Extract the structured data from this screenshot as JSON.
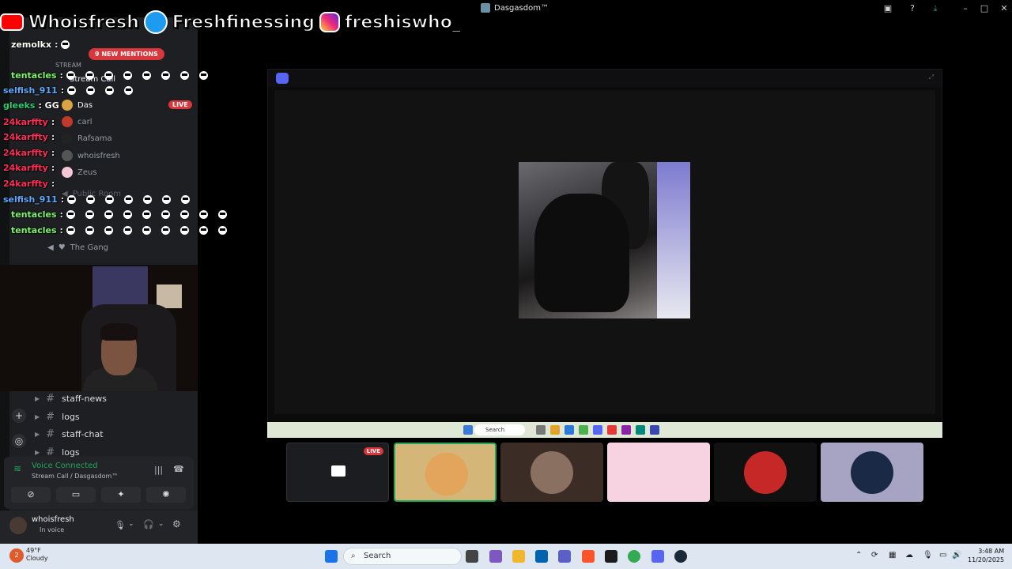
{
  "window": {
    "title": "Dasgasdom™"
  },
  "social": {
    "youtube": "Whoisfresh",
    "twitter": "Freshfinessing",
    "instagram": "freshiswho_"
  },
  "sidebar": {
    "mentions_badge": "9 NEW MENTIONS",
    "stream_header": "STREAM",
    "stream_call": "Stream Call",
    "live_badge": "LIVE",
    "voice_users": [
      "Das",
      "carl",
      "Rafsama",
      "whoisfresh",
      "Zeus"
    ],
    "public_room": "Public Room",
    "the_gang": "The Gang",
    "channels": [
      "staff-news",
      "logs",
      "staff-chat",
      "logs"
    ]
  },
  "chat": [
    {
      "user": "zemolkx",
      "color": "#ffffff",
      "msg": ":"
    },
    {
      "user": "tentacles",
      "color": "#7cf56a",
      "msg": ":"
    },
    {
      "user": "selfish_911",
      "color": "#5da9ff",
      "msg": ":"
    },
    {
      "user": "gleeks",
      "color": "#2ecc71",
      "msg": ": GG"
    },
    {
      "user": "24karffty",
      "color": "#ff2d55",
      "msg": ":"
    },
    {
      "user": "24karffty",
      "color": "#ff2d55",
      "msg": ":"
    },
    {
      "user": "24karffty",
      "color": "#ff2d55",
      "msg": ":"
    },
    {
      "user": "24karffty",
      "color": "#ff2d55",
      "msg": ":"
    },
    {
      "user": "24karffty",
      "color": "#ff2d55",
      "msg": ":"
    },
    {
      "user": "selfish_911",
      "color": "#5da9ff",
      "msg": ":"
    },
    {
      "user": "tentacles",
      "color": "#7cf56a",
      "msg": ":"
    },
    {
      "user": "tentacles",
      "color": "#7cf56a",
      "msg": ":"
    }
  ],
  "voice": {
    "status": "Voice Connected",
    "location": "Stream Call / Dasgasdom™"
  },
  "user": {
    "name": "whoisfresh",
    "status": "In voice"
  },
  "tiles": {
    "live_badge": "LIVE"
  },
  "taskbar": {
    "weather_temp": "49°F",
    "weather_desc": "Cloudy",
    "weather_badge": "2",
    "search_placeholder": "Search",
    "time": "3:48 AM",
    "date": "11/20/2025"
  },
  "inner_taskbar": {
    "search": "Search"
  },
  "colors": {
    "discord_blurple": "#5865f2",
    "live_red": "#da373c",
    "voice_green": "#23a55a"
  }
}
